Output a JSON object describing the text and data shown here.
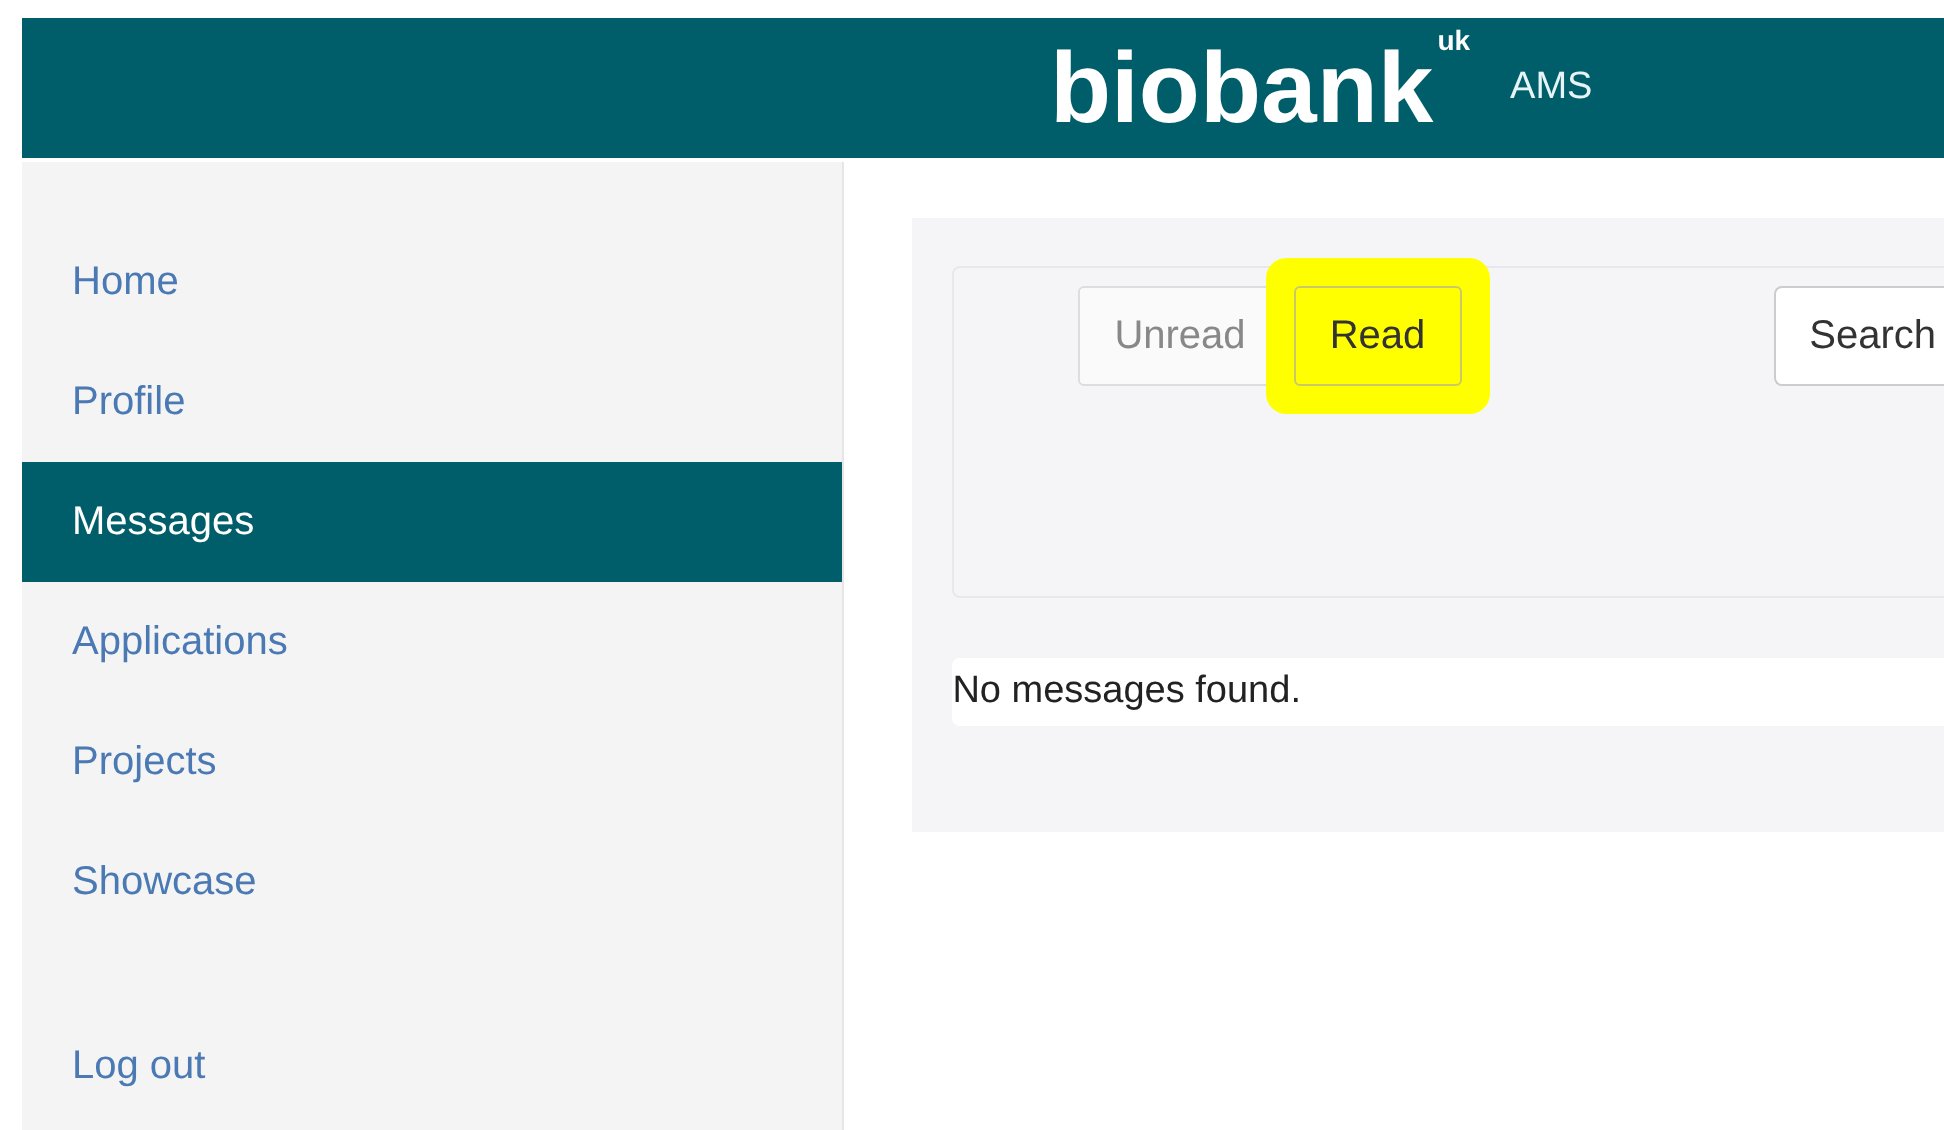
{
  "header": {
    "logo": "biobank",
    "logo_suffix": "uk",
    "app_name": "AMS"
  },
  "sidebar": {
    "items": [
      {
        "label": "Home",
        "selected": false
      },
      {
        "label": "Profile",
        "selected": false
      },
      {
        "label": "Messages",
        "selected": true
      },
      {
        "label": "Applications",
        "selected": false
      },
      {
        "label": "Projects",
        "selected": false
      },
      {
        "label": "Showcase",
        "selected": false
      }
    ],
    "footer_item": {
      "label": "Log out"
    }
  },
  "filters": [
    {
      "label": "Unread",
      "selected": false
    },
    {
      "label": "Read",
      "selected": true
    }
  ],
  "search_button": "Search",
  "empty_message": "No messages found."
}
